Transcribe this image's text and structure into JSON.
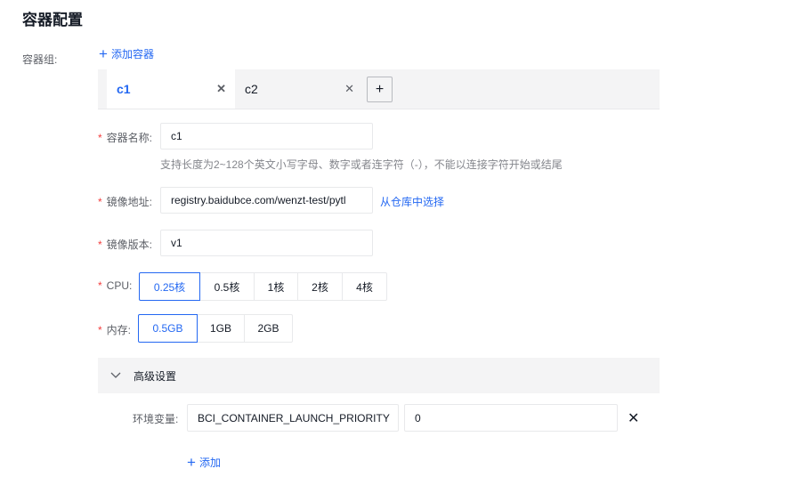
{
  "page": {
    "title": "容器配置"
  },
  "container_group": {
    "label": "容器组:",
    "add_label": "添加容器",
    "tabs": [
      {
        "label": "c1",
        "active": true
      },
      {
        "label": "c2",
        "active": false
      }
    ],
    "add_tab_icon": "+"
  },
  "form": {
    "name": {
      "label": "容器名称:",
      "value": "c1",
      "hint": "支持长度为2~128个英文小写字母、数字或者连字符（-），不能以连接字符开始或结尾"
    },
    "image": {
      "label": "镜像地址:",
      "value": "registry.baidubce.com/wenzt-test/pytl",
      "link": "从仓库中选择"
    },
    "version": {
      "label": "镜像版本:",
      "value": "v1"
    },
    "cpu": {
      "label": "CPU:",
      "options": [
        "0.25核",
        "0.5核",
        "1核",
        "2核",
        "4核"
      ],
      "selected": "0.25核"
    },
    "memory": {
      "label": "内存:",
      "options": [
        "0.5GB",
        "1GB",
        "2GB"
      ],
      "selected": "0.5GB"
    }
  },
  "advanced": {
    "title": "高级设置",
    "expanded": true,
    "env": {
      "label": "环境变量:",
      "key": "BCI_CONTAINER_LAUNCH_PRIORITY",
      "value": "0",
      "add_label": "添加"
    }
  },
  "colors": {
    "accent": "#2468f2",
    "required": "#f33e3e",
    "panel": "#f4f4f5"
  },
  "icons": {
    "plus": "plus-icon",
    "close": "close-icon",
    "chevron": "chevron-down-icon"
  }
}
